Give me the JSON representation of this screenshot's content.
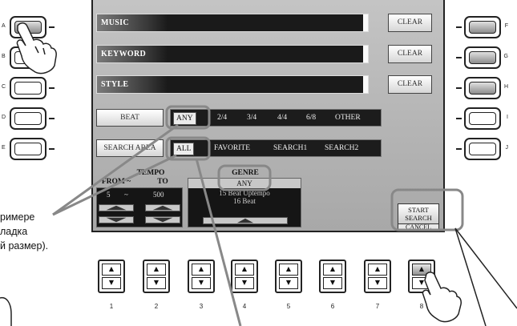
{
  "left_buttons": [
    {
      "label": "A",
      "lit": true
    },
    {
      "label": "B",
      "lit": false
    },
    {
      "label": "C",
      "lit": false
    },
    {
      "label": "D",
      "lit": false
    },
    {
      "label": "E",
      "lit": false
    }
  ],
  "right_buttons": [
    {
      "label": "F",
      "lit": true
    },
    {
      "label": "G",
      "lit": true
    },
    {
      "label": "H",
      "lit": true
    },
    {
      "label": "I",
      "lit": false
    },
    {
      "label": "J",
      "lit": false
    }
  ],
  "search": {
    "music_label": "MUSIC",
    "keyword_label": "KEYWORD",
    "style_label": "STYLE",
    "clear_label": "CLEAR",
    "beat_label": "BEAT",
    "beat_options": [
      "ANY",
      "2/4",
      "3/4",
      "4/4",
      "6/8",
      "OTHER"
    ],
    "beat_selected": "ANY",
    "area_label": "SEARCH AREA",
    "area_options": [
      "ALL",
      "FAVORITE",
      "SEARCH1",
      "SEARCH2"
    ],
    "area_selected": "ALL",
    "tempo_title": "TEMPO",
    "tempo_from": "FROM ~",
    "tempo_to": "TO",
    "tempo_from_value": "5",
    "tempo_sep": "~",
    "tempo_to_value": "500",
    "genre_title": "GENRE",
    "genre_selected": "ANY",
    "genre_items": [
      "15 Beat Uptempo",
      "16 Beat"
    ],
    "start_label_1": "START",
    "start_label_2": "SEARCH",
    "cancel_label": "CANCEL"
  },
  "bottom_buttons": [
    "1",
    "2",
    "3",
    "4",
    "5",
    "6",
    "7",
    "8"
  ],
  "bottom_lit_index": 8,
  "up_glyph": "▲",
  "down_glyph": "▼",
  "callout_lines": [
    "римере",
    "ладка",
    "й размер)."
  ]
}
